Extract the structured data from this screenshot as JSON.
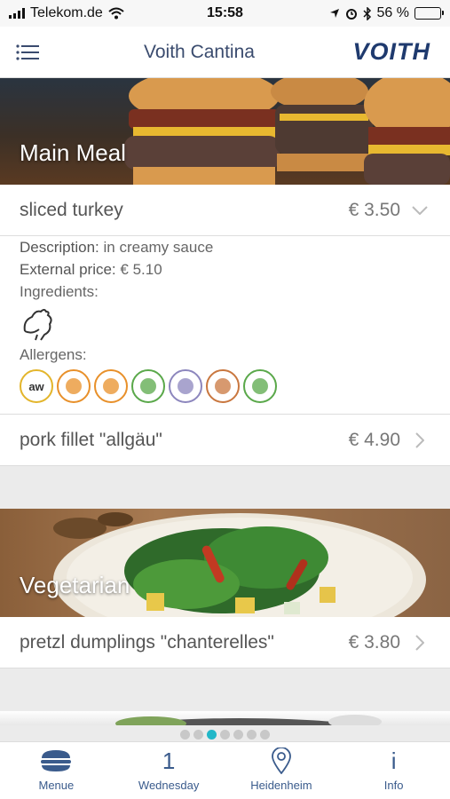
{
  "status_bar": {
    "carrier": "Telekom.de",
    "time": "15:58",
    "battery_percent": "56 %",
    "battery_level": 0.56
  },
  "navbar": {
    "menu_icon": "hamburger-menu-icon",
    "title": "Voith Cantina",
    "brand": "VOITH"
  },
  "sections": [
    {
      "label": "Main Meal",
      "dishes": [
        {
          "name": "sliced turkey",
          "price": "€ 3.50",
          "expanded": true,
          "description_label": "Description:",
          "description": "in creamy sauce",
          "external_price_label": "External price:",
          "external_price": "€ 5.10",
          "ingredients_label": "Ingredients:",
          "ingredients_icon": "poultry-icon",
          "allergens_label": "Allergens:",
          "allergens": [
            {
              "icon": "wheat-icon",
              "text": "aw",
              "color": "#e3b52b"
            },
            {
              "icon": "egg-icon",
              "text": "",
              "color": "#e8902a"
            },
            {
              "icon": "chicken-leg-icon",
              "text": "",
              "color": "#e8902a"
            },
            {
              "icon": "legumes-icon",
              "text": "",
              "color": "#5aa84a"
            },
            {
              "icon": "milk-icon",
              "text": "",
              "color": "#8c86bd"
            },
            {
              "icon": "nuts-icon",
              "text": "",
              "color": "#c9773f"
            },
            {
              "icon": "celery-icon",
              "text": "",
              "color": "#5aa84a"
            }
          ]
        },
        {
          "name": "pork fillet \"allgäu\"",
          "price": "€ 4.90",
          "expanded": false
        }
      ]
    },
    {
      "label": "Vegetarian",
      "dishes": [
        {
          "name": "pretzl dumplings \"chanterelles\"",
          "price": "€ 3.80",
          "expanded": false
        }
      ]
    }
  ],
  "pager": {
    "count": 7,
    "active_index": 2
  },
  "tabbar": [
    {
      "label": "Menue",
      "icon": "burger-icon"
    },
    {
      "label": "Wednesday",
      "icon": "day-number",
      "value": "1"
    },
    {
      "label": "Heidenheim",
      "icon": "location-pin-icon"
    },
    {
      "label": "Info",
      "icon": "info-icon",
      "value": "i"
    }
  ],
  "colors": {
    "brand": "#1f3a6e",
    "accent": "#22b7c8",
    "tab": "#3a5b8c"
  }
}
